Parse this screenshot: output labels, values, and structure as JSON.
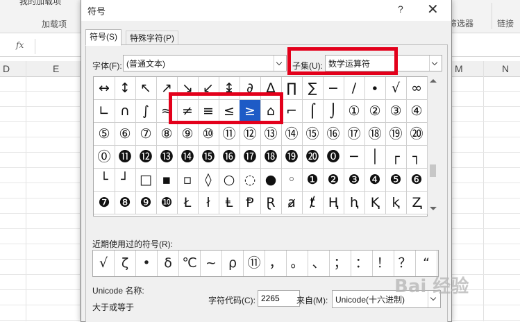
{
  "excel": {
    "ribbon": {
      "addins_top_label": "我的加载项",
      "addins_group_label": "加载项",
      "filter_label": "筛选器",
      "link_label": "链接"
    },
    "fx_label": "fx",
    "columns": [
      "D",
      "E",
      "M",
      "N"
    ]
  },
  "dialog": {
    "title": "符号",
    "help_label": "?",
    "close_label": "✕",
    "tabs": {
      "symbols": "符号(S)",
      "special": "特殊字符(P)"
    },
    "font_label": "字体(F):",
    "font_value": "(普通文本)",
    "subset_label": "子集(U):",
    "subset_value": "数学运算符",
    "symbol_rows": [
      [
        "↔",
        "↕",
        "↖",
        "↗",
        "↘",
        "↙",
        "↨",
        "∂",
        "∆",
        "∏",
        "∑",
        "−",
        "∕",
        "∙",
        "√",
        "∞"
      ],
      [
        "∟",
        "∩",
        "∫",
        "≈",
        "≠",
        "≡",
        "≤",
        "≥",
        "⌂",
        "⌐",
        "⌠",
        "⌡",
        "①",
        "②",
        "③",
        "④"
      ],
      [
        "⑤",
        "⑥",
        "⑦",
        "⑧",
        "⑨",
        "⑩",
        "⑪",
        "⑫",
        "⑬",
        "⑭",
        "⑮",
        "⑯",
        "⑰",
        "⑱",
        "⑲",
        "⑳"
      ],
      [
        "⓪",
        "⓫",
        "⓬",
        "⓭",
        "⓮",
        "⓯",
        "⓰",
        "⓱",
        "⓲",
        "⓳",
        "⓴",
        "⓿",
        "─",
        "│",
        "┌",
        "┐"
      ],
      [
        "└",
        "┘",
        "□",
        "▪",
        "▫",
        "◊",
        "○",
        "◌",
        "●",
        "◦",
        "❶",
        "❷",
        "❸",
        "❹",
        "❺",
        "❻"
      ],
      [
        "❼",
        "❽",
        "❾",
        "❿",
        "Ł",
        "ł",
        "Ⱡ",
        "Ᵽ",
        "Ɽ",
        "ⱥ",
        "ⱦ",
        "Ⱨ",
        "ⱨ",
        "Ⱪ",
        "ⱪ",
        "Ⱬ"
      ]
    ],
    "selected_symbol": "≥",
    "recent_label": "近期使用过的符号(R):",
    "recent_symbols": [
      "√",
      "ζ",
      "•",
      "δ",
      "℃",
      "~",
      "ρ",
      "⑪",
      "，",
      "。",
      "、",
      "；",
      "：",
      "！",
      "？",
      "“"
    ],
    "unicode_name_label": "Unicode 名称:",
    "unicode_name_value": "大于或等于",
    "charcode_label": "字符代码(C):",
    "charcode_value": "2265",
    "from_label": "来自(M):",
    "from_value": "Unicode(十六进制)"
  },
  "watermark_text": "Bai 经验",
  "colors": {
    "selection": "#1e5bc6",
    "highlight_border": "#e3001b"
  }
}
